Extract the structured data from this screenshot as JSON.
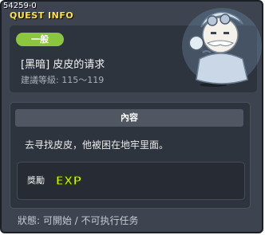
{
  "quest": {
    "id": "54259-0",
    "window_title": "QUEST INFO",
    "type_badge": "一般",
    "name": "[黑暗] 皮皮的请求",
    "recommended_level": "建議等級: 115～119"
  },
  "content": {
    "header": "內容",
    "description": "去寻找皮皮，他被困在地牢里面。"
  },
  "reward": {
    "label": "獎勵",
    "exp_icon": "exp-icon",
    "exp_text": "EXP"
  },
  "status": {
    "text": "狀態: 可開始 / 不可执行任务"
  },
  "colors": {
    "badge": "#8cc63f",
    "title": "#ffe14a",
    "exp": "#d7f227"
  }
}
